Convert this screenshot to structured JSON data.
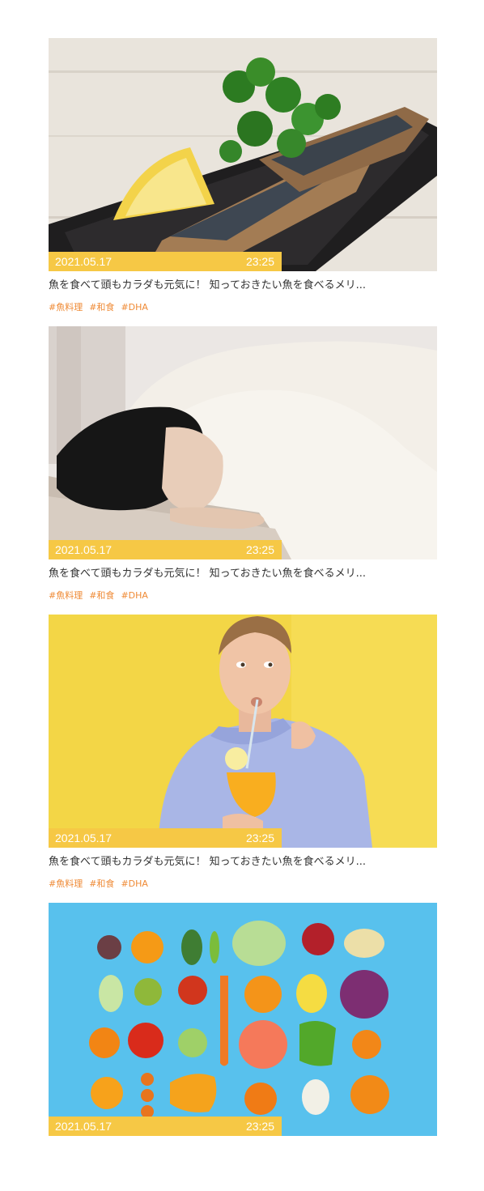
{
  "articles": [
    {
      "date": "2021.05.17",
      "time": "23:25",
      "title": "魚を食べて頭もカラダも元気に！ 知っておきたい魚を食べるメリ...",
      "tags": [
        "#魚料理",
        "#和食",
        "#DHA"
      ],
      "image": "grilled-mackerel-photo"
    },
    {
      "date": "2021.05.17",
      "time": "23:25",
      "title": "魚を食べて頭もカラダも元気に！ 知っておきたい魚を食べるメリ...",
      "tags": [
        "#魚料理",
        "#和食",
        "#DHA"
      ],
      "image": "sleeping-woman-photo"
    },
    {
      "date": "2021.05.17",
      "time": "23:25",
      "title": "魚を食べて頭もカラダも元気に！ 知っておきたい魚を食べるメリ...",
      "tags": [
        "#魚料理",
        "#和食",
        "#DHA"
      ],
      "image": "man-drinking-juice-photo"
    },
    {
      "date": "2021.05.17",
      "time": "23:25",
      "title": "",
      "tags": [],
      "image": "fruits-vegetables-photo"
    }
  ],
  "colors": {
    "meta_bar": "#f6c845",
    "tag": "#ef8a35",
    "title": "#333333"
  }
}
